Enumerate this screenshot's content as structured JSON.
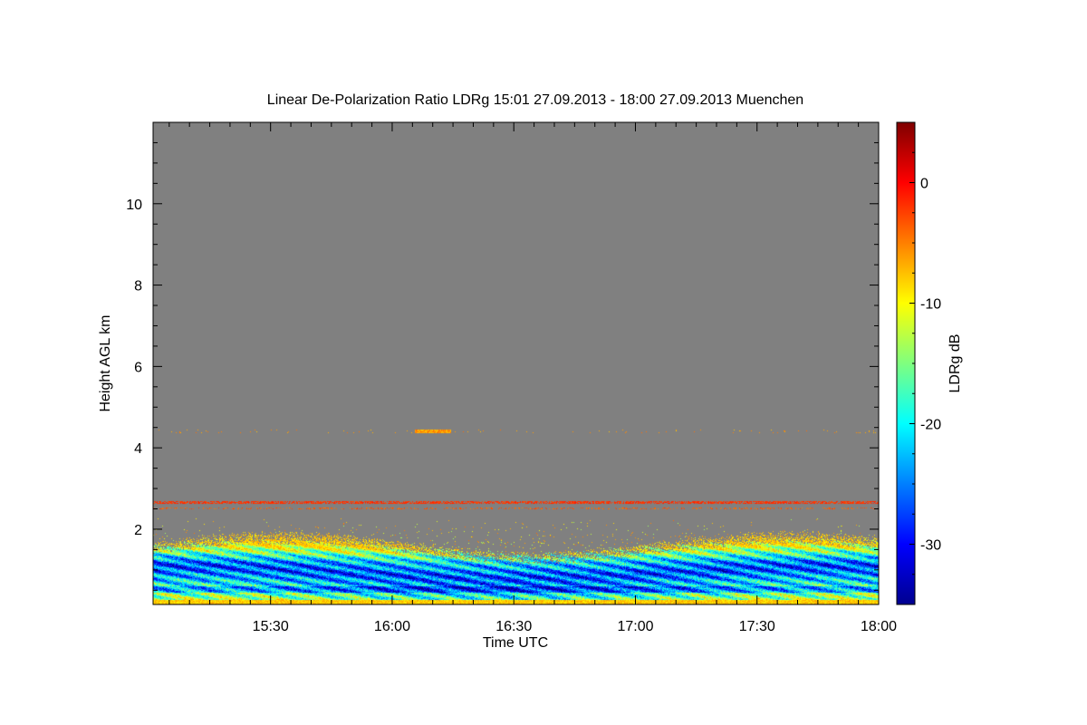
{
  "chart_data": {
    "type": "heatmap",
    "title": "Linear De-Polarization Ratio LDRg   15:01 27.09.2013 - 18:00 27.09.2013 Muenchen",
    "xlabel": "Time UTC",
    "ylabel": "Height AGL km",
    "colorbar_label": "LDRg dB",
    "x_ticks": [
      {
        "value": 15.5,
        "label": "15:30"
      },
      {
        "value": 16.0,
        "label": "16:00"
      },
      {
        "value": 16.5,
        "label": "16:30"
      },
      {
        "value": 17.0,
        "label": "17:00"
      },
      {
        "value": 17.5,
        "label": "17:30"
      },
      {
        "value": 18.0,
        "label": "18:00"
      }
    ],
    "xlim": [
      15.017,
      18.0
    ],
    "y_ticks": [
      {
        "value": 2,
        "label": "2"
      },
      {
        "value": 4,
        "label": "4"
      },
      {
        "value": 6,
        "label": "6"
      },
      {
        "value": 8,
        "label": "8"
      },
      {
        "value": 10,
        "label": "10"
      }
    ],
    "ylim": [
      0.15,
      12.0
    ],
    "colorbar_ticks": [
      {
        "value": 0,
        "label": "0"
      },
      {
        "value": -10,
        "label": "-10"
      },
      {
        "value": -20,
        "label": "-20"
      },
      {
        "value": -30,
        "label": "-30"
      }
    ],
    "colorbar_range": [
      -35,
      5
    ],
    "colormap": "jet",
    "background_color": "#808080",
    "grid": false,
    "legend": "colorbar-right",
    "features": [
      {
        "kind": "layer",
        "height_km": 2.67,
        "ldr_db": -3
      },
      {
        "kind": "layer",
        "height_km": 2.52,
        "ldr_db": -5
      },
      {
        "kind": "layer",
        "height_km": 4.42,
        "ldr_db": -6
      },
      {
        "kind": "boundary_layer",
        "top_km": 1.7,
        "core_km": 1.0,
        "ldr_db_range": [
          -33,
          -10
        ]
      }
    ]
  }
}
